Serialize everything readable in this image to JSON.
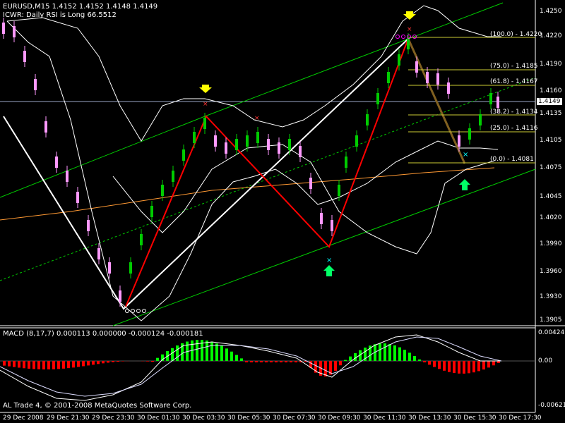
{
  "header": {
    "symbol_line": "EURUSD,M15  1.4152 1.4152 1.4148 1.4149",
    "indicator_line": "ICWR: Daily RSI is Long 66.5512"
  },
  "macd": {
    "label": "MACD  (8,17,7) 0.000113 0.000000 -0.000124 -0.000181",
    "axis": [
      "0.00424",
      "0.00",
      "-0.00621"
    ]
  },
  "price_axis": [
    "1.4250",
    "1.4220",
    "1.4190",
    "1.4160",
    "1.4135",
    "1.4105",
    "1.4075",
    "1.4045",
    "1.4020",
    "1.3990",
    "1.3960",
    "1.3930",
    "1.3905"
  ],
  "current_price": "1.4149",
  "fib_levels": [
    "(100.0) - 1.4220",
    "(75.0) - 1.4185",
    "(61.8) - 1.4167",
    "(38.2) - 1.4134",
    "(25.0) - 1.4116",
    "(0.0) - 1.4081"
  ],
  "time_axis": [
    "29 Dec 2008",
    "29 Dec 21:30",
    "29 Dec 23:30",
    "30 Dec 01:30",
    "30 Dec 03:30",
    "30 Dec 05:30",
    "30 Dec 07:30",
    "30 Dec 09:30",
    "30 Dec 11:30",
    "30 Dec 13:30",
    "30 Dec 15:30",
    "30 Dec 17:30"
  ],
  "copyright": "AL Trade 4, © 2001-2008 MetaQuotes Software Corp.",
  "colors": {
    "background": "#000000",
    "bull_candle": "#00cc00",
    "bear_candle": "#ff99ff",
    "channel": "#00cc00",
    "bollinger": "#ffffff",
    "zigzag_red": "#ff0000",
    "zigzag_white": "#ffffff",
    "ma_orange": "#ff9933",
    "fib": "#ffff00",
    "macd_pos": "#00ff00",
    "macd_neg": "#ff0000",
    "arrow_yellow": "#ffff00",
    "arrow_green": "#00ff66",
    "marker_cyan": "#00ffff",
    "marker_magenta": "#ff00ff"
  }
}
